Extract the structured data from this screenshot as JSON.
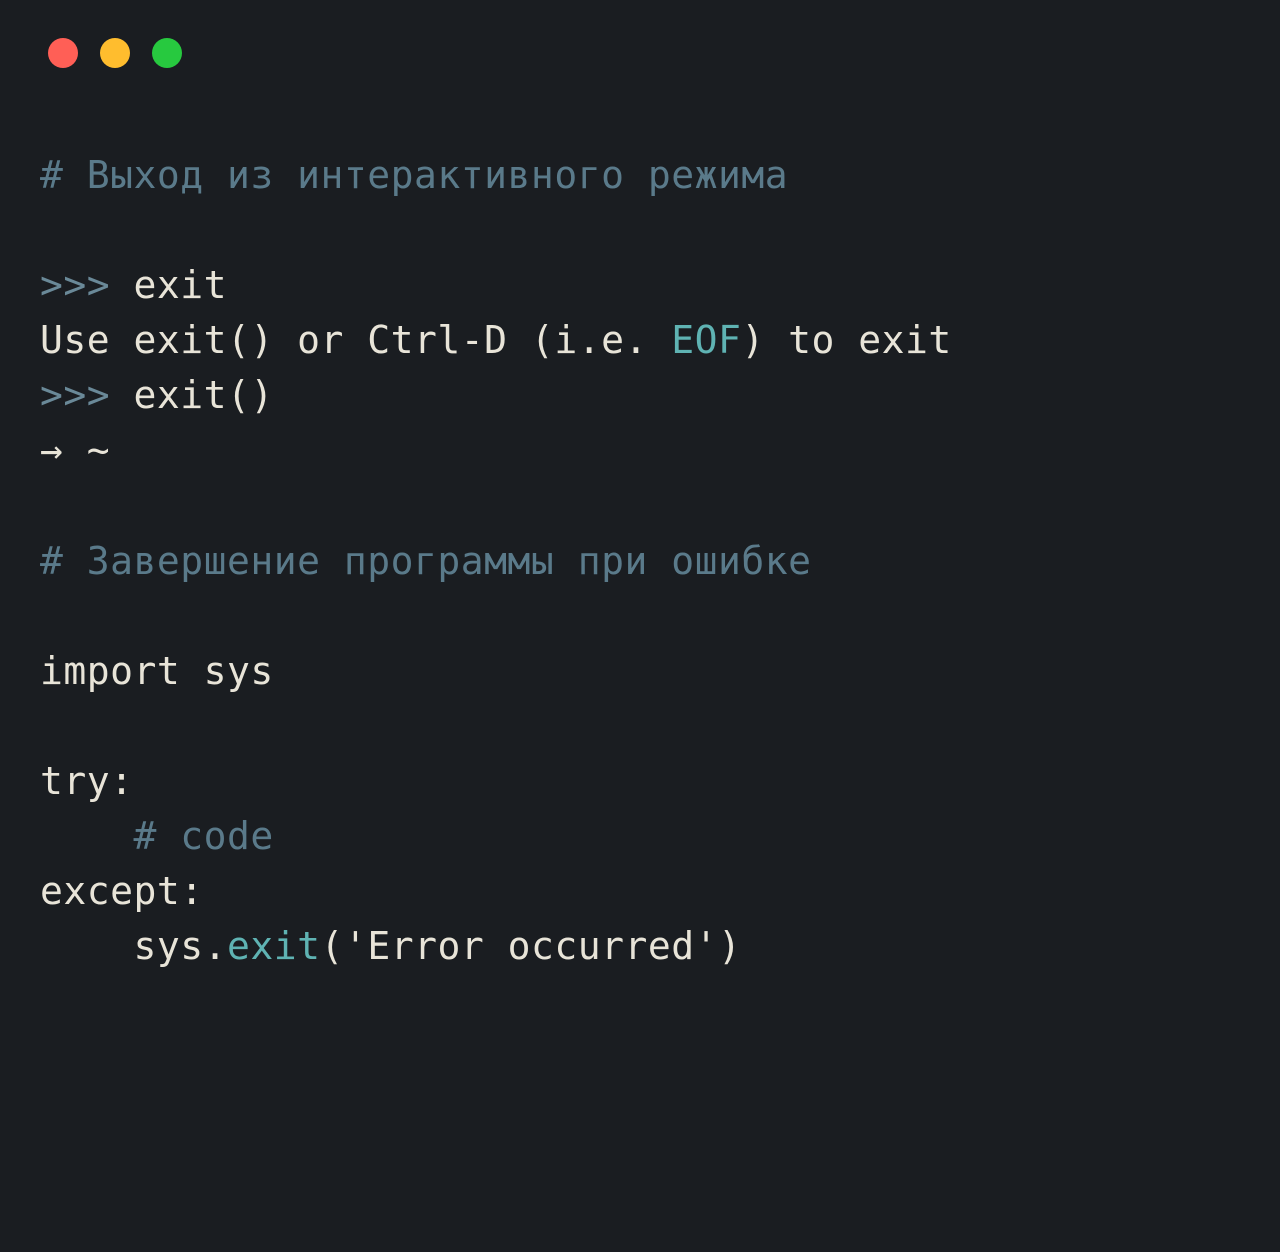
{
  "window": {
    "traffic_light_colors": {
      "red": "#ff5f56",
      "yellow": "#ffbd2e",
      "green": "#27c93f"
    }
  },
  "code": {
    "comment1": "# Выход из интерактивного режима",
    "blank": "",
    "line1_prompt": ">>> ",
    "line1_cmd": "exit",
    "line2_a": "Use exit() or Ctrl-D (i.e. ",
    "line2_eof": "EOF",
    "line2_b": ") to exit",
    "line3_prompt": ">>> ",
    "line3_cmd": "exit()",
    "line4": "→ ~",
    "comment2": "# Завершение программы при ошибке",
    "line5a": "import",
    "line5b": " sys",
    "line6": "try:",
    "line7_indent": "    ",
    "line7_comment": "# code",
    "line8": "except:",
    "line9_indent": "    sys.",
    "line9_call": "exit",
    "line9_paren_open": "(",
    "line9_str": "'Error occurred'",
    "line9_paren_close": ")"
  }
}
